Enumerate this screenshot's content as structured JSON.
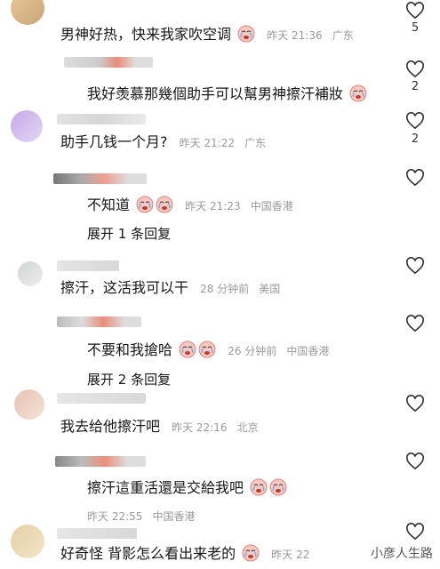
{
  "comments": [
    {
      "text": "男神好热，快来我家吹空调",
      "emojis": [
        "cry-face"
      ],
      "time": "昨天 21:36",
      "location": "广东",
      "likes": "5"
    },
    {
      "text": "我好羡慕那幾個助手可以幫男神擦汗補妝",
      "emojis": [
        "cry-face"
      ],
      "time": "",
      "location": "",
      "likes": "2"
    },
    {
      "text": "助手几钱一个月?",
      "emojis": [],
      "time": "昨天 21:22",
      "location": "广东",
      "likes": "2"
    },
    {
      "text": "不知道",
      "emojis": [
        "cry-face",
        "cry-face"
      ],
      "time": "昨天 21:23",
      "location": "中国香港",
      "likes": ""
    },
    {
      "text": "擦汗，这活我可以干",
      "emojis": [],
      "time": "28 分钟前",
      "location": "美国",
      "likes": ""
    },
    {
      "text": "不要和我搶哈",
      "emojis": [
        "cry-face",
        "cry-face"
      ],
      "time": "26 分钟前",
      "location": "中国香港",
      "likes": ""
    },
    {
      "text": "我去给他擦汗吧",
      "emojis": [],
      "time": "昨天 22:16",
      "location": "北京",
      "likes": ""
    },
    {
      "text": "擦汗這重活還是交給我吧",
      "emojis": [
        "cry-face",
        "cry-face"
      ],
      "time": "",
      "location": "",
      "likes": ""
    },
    {
      "text": "",
      "emojis": [],
      "time": "昨天 22:55",
      "location": "中国香港",
      "likes": ""
    },
    {
      "text": "好奇怪 背影怎么看出来老的",
      "emojis": [
        "cry-face"
      ],
      "time": "昨天 22",
      "location": "",
      "likes": ""
    }
  ],
  "expand_replies": [
    "展开 1 条回复",
    "展开 2 条回复"
  ],
  "watermark": "小彦人生路",
  "colors": {
    "text": "#161616",
    "meta": "#9a9a9a",
    "heart": "#333333"
  }
}
